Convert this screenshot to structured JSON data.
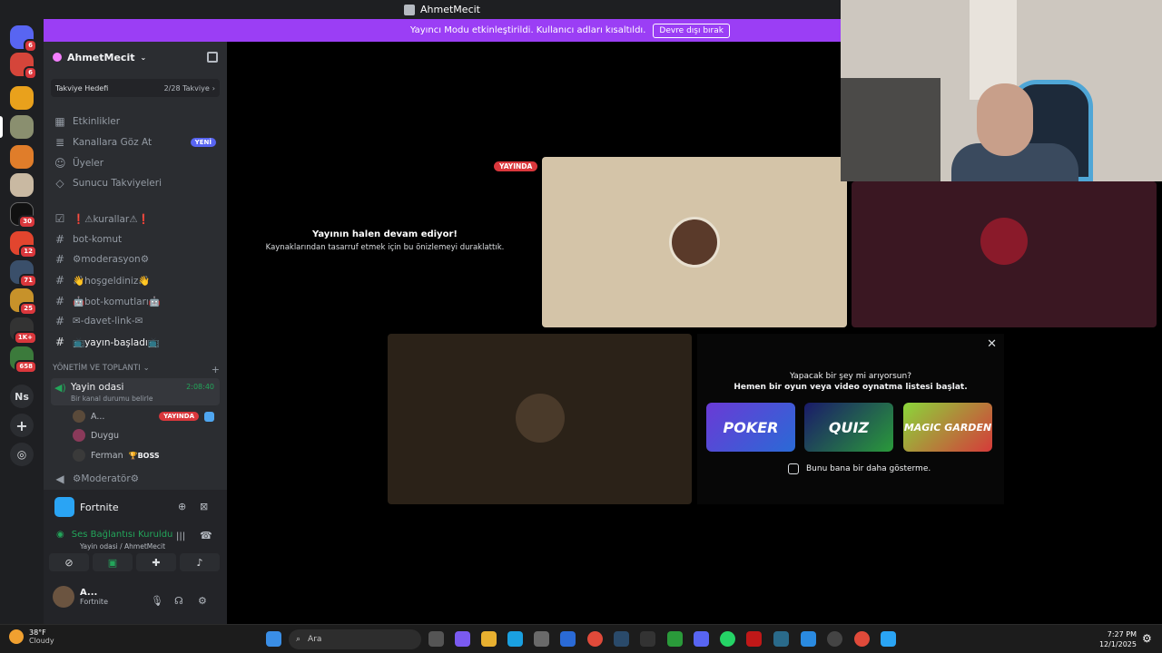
{
  "window": {
    "title": "AhmetMecit"
  },
  "banner": {
    "text": "Yayıncı Modu etkinleştirildi. Kullanıcı adları kısaltıldı.",
    "button": "Devre dışı bırak",
    "color": "#9b3ef5"
  },
  "rail": {
    "badges": [
      "6",
      "6",
      "30",
      "12",
      "71",
      "25",
      "1K+",
      "658"
    ],
    "text_server": "Ns"
  },
  "guild": {
    "name": "AhmetMecit",
    "boost": {
      "label": "Takviye Hedefi",
      "progress": "2/28 Takviye"
    },
    "menu": [
      {
        "label": "Etkinlikler",
        "icon": "calendar-icon"
      },
      {
        "label": "Kanallara Göz At",
        "icon": "browse-icon",
        "tag": "YENİ"
      },
      {
        "label": "Üyeler",
        "icon": "members-icon"
      },
      {
        "label": "Sunucu Takviyeleri",
        "icon": "boost-icon"
      }
    ],
    "channels": [
      {
        "label": "❗⚠kurallar⚠❗",
        "icon": "rules-icon"
      },
      {
        "label": "bot-komut",
        "icon": "hash-icon"
      },
      {
        "label": "⚙moderasyon⚙",
        "icon": "hash-icon"
      },
      {
        "label": "👋hoşgeldiniz👋",
        "icon": "hash-icon"
      },
      {
        "label": "🤖bot-komutları🤖",
        "icon": "hash-icon"
      },
      {
        "label": "✉-davet-link-✉",
        "icon": "hash-icon"
      },
      {
        "label": "📺yayın-başladı📺",
        "icon": "hash-icon"
      }
    ],
    "category": "YÖNETİM VE TOPLANTI",
    "voice": {
      "name": "Yayin odasi",
      "status": "Bir kanal durumu belirle",
      "time": "2:08:40"
    },
    "members": [
      {
        "name": "A...",
        "live": "YAYINDA"
      },
      {
        "name": "Duygu"
      },
      {
        "name": "Ferman",
        "tag": "🏆BOSS"
      }
    ],
    "next_voice": "⚙Moderatör⚙"
  },
  "panel": {
    "game": "Fortnite",
    "connection": "Ses Bağlantısı Kuruldu",
    "connection_sub": "Yayin odasi / AhmetMecit",
    "user": {
      "name": "A...",
      "status": "Fortnite"
    }
  },
  "stage": {
    "paused_title": "Yayının halen devam ediyor!",
    "paused_sub": "Kaynaklarından tasarruf etmek için bu önizlemeyi duraklattık.",
    "live_badge": "YAYINDA"
  },
  "promo": {
    "line1": "Yapacak bir şey mi arıyorsun?",
    "line2": "Hemen bir oyun veya video oynatma listesi başlat.",
    "games": [
      "POKER",
      "QUIZ",
      "MAGIC GARDEN"
    ],
    "checkbox": "Bunu bana bir daha gösterme."
  },
  "taskbar": {
    "weather_temp": "38°F",
    "weather_desc": "Cloudy",
    "search": "Ara",
    "time": "7:27 PM",
    "date": "12/1/2025"
  }
}
